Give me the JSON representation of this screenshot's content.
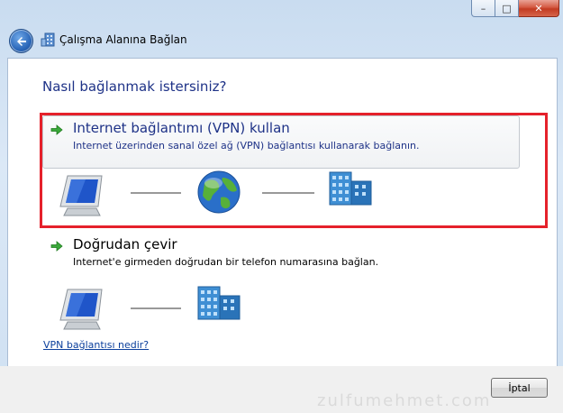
{
  "window": {
    "title": "Çalışma Alanına Bağlan",
    "caption": {
      "minimize": "–",
      "maximize": "□",
      "close": "✕"
    }
  },
  "heading": "Nasıl bağlanmak istersiniz?",
  "options": [
    {
      "title": "Internet bağlantımı (VPN) kullan",
      "description": "Internet üzerinden sanal özel ağ (VPN) bağlantısı kullanarak bağlanın.",
      "icons": [
        "computer-icon",
        "globe-icon",
        "office-building-icon"
      ]
    },
    {
      "title": "Doğrudan çevir",
      "description": "Internet'e girmeden doğrudan bir telefon numarasına bağlan.",
      "icons": [
        "computer-icon",
        "office-building-icon"
      ]
    }
  ],
  "help_link": "VPN bağlantısı nedir?",
  "cancel_label": "İptal",
  "watermark": "zulfumehmet.com",
  "colors": {
    "highlight_border": "#e5212b",
    "heading": "#1e3287",
    "link": "#0b3f9c"
  }
}
